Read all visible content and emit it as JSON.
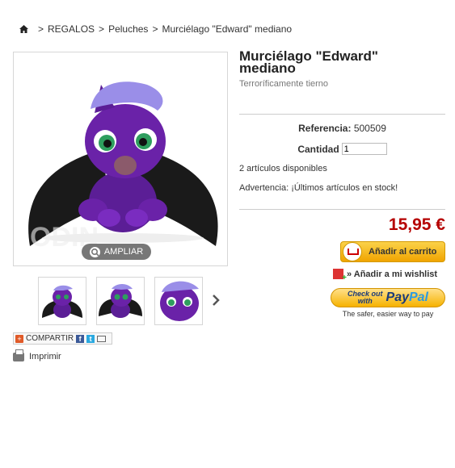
{
  "breadcrumb": {
    "items": [
      "REGALOS",
      "Peluches",
      "Murciélago \"Edward\" mediano"
    ],
    "separator": ">"
  },
  "product": {
    "title": "Murciélago \"Edward\" mediano",
    "subtitle": "Terroríficamente tierno",
    "reference_label": "Referencia:",
    "reference_value": "500509",
    "quantity_label": "Cantidad",
    "quantity_value": "1",
    "availability": "2 artículos disponibles",
    "warning": "Advertencia: ¡Últimos artículos en stock!",
    "price": "15,95 €"
  },
  "image": {
    "zoom_label": "AMPLIAR",
    "watermark": "ODIN"
  },
  "actions": {
    "add_to_cart": "Añadir al carrito",
    "wishlist": "» Añadir a mi wishlist",
    "paypal_checkout_line1": "Check out",
    "paypal_checkout_line2": "with",
    "paypal_brand_a": "Pay",
    "paypal_brand_b": "Pal",
    "paypal_tagline": "The safer, easier way to pay",
    "share": "COMPARTIR",
    "print": "Imprimir"
  },
  "colors": {
    "price": "#b50000",
    "plush_purple": "#6a22a8",
    "wing_black": "#1a1a1a",
    "cart_yellow": "#f4b400"
  },
  "icons": [
    "home-icon",
    "zoom-icon",
    "chevron-right-icon",
    "share-plus-icon",
    "facebook-icon",
    "twitter-icon",
    "mail-icon",
    "printer-icon",
    "cart-icon",
    "gift-icon"
  ]
}
